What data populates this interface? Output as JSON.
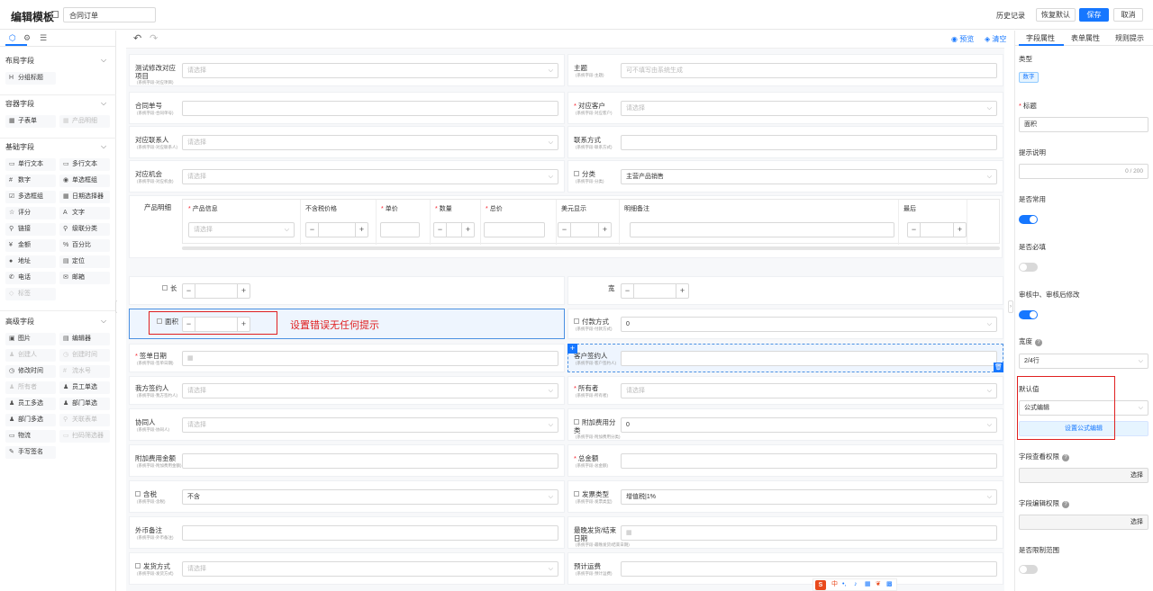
{
  "topbar": {
    "title": "编辑模板",
    "template_name": "合同订单",
    "history": "历史记录",
    "restore_default": "恢复默认",
    "save": "保存",
    "cancel": "取消"
  },
  "left": {
    "sections": [
      {
        "title": "布局字段",
        "items": [
          {
            "label": "分组标题",
            "icon": "H",
            "disabled": false
          }
        ]
      },
      {
        "title": "容器字段",
        "items": [
          {
            "label": "子表单",
            "icon": "▦",
            "disabled": false
          },
          {
            "label": "产品明细",
            "icon": "▦",
            "disabled": true
          }
        ]
      },
      {
        "title": "基础字段",
        "items": [
          {
            "label": "单行文本",
            "icon": "▭",
            "disabled": false
          },
          {
            "label": "多行文本",
            "icon": "▭",
            "disabled": false
          },
          {
            "label": "数字",
            "icon": "#",
            "disabled": false
          },
          {
            "label": "单选框组",
            "icon": "◉",
            "disabled": false
          },
          {
            "label": "多选框组",
            "icon": "☑",
            "disabled": false
          },
          {
            "label": "日期选择器",
            "icon": "▦",
            "disabled": false
          },
          {
            "label": "评分",
            "icon": "☆",
            "disabled": false
          },
          {
            "label": "文字",
            "icon": "A",
            "disabled": false
          },
          {
            "label": "链接",
            "icon": "⚲",
            "disabled": false
          },
          {
            "label": "级联分类",
            "icon": "⚲",
            "disabled": false
          },
          {
            "label": "金额",
            "icon": "¥",
            "disabled": false
          },
          {
            "label": "百分比",
            "icon": "%",
            "disabled": false
          },
          {
            "label": "地址",
            "icon": "●",
            "disabled": false
          },
          {
            "label": "定位",
            "icon": "▤",
            "disabled": false
          },
          {
            "label": "电话",
            "icon": "✆",
            "disabled": false
          },
          {
            "label": "邮箱",
            "icon": "✉",
            "disabled": false
          },
          {
            "label": "标签",
            "icon": "◇",
            "disabled": true
          }
        ]
      },
      {
        "title": "高级字段",
        "items": [
          {
            "label": "图片",
            "icon": "▣",
            "disabled": false
          },
          {
            "label": "编辑器",
            "icon": "▤",
            "disabled": false
          },
          {
            "label": "创建人",
            "icon": "♟",
            "disabled": true
          },
          {
            "label": "创建时间",
            "icon": "◷",
            "disabled": true
          },
          {
            "label": "修改时间",
            "icon": "◷",
            "disabled": false
          },
          {
            "label": "流水号",
            "icon": "#",
            "disabled": true
          },
          {
            "label": "所有者",
            "icon": "♟",
            "disabled": true
          },
          {
            "label": "员工单选",
            "icon": "♟",
            "disabled": false
          },
          {
            "label": "员工多选",
            "icon": "♟",
            "disabled": false
          },
          {
            "label": "部门单选",
            "icon": "♟",
            "disabled": false
          },
          {
            "label": "部门多选",
            "icon": "♟",
            "disabled": false
          },
          {
            "label": "关联表单",
            "icon": "⚲",
            "disabled": true
          },
          {
            "label": "物流",
            "icon": "▭",
            "disabled": false
          },
          {
            "label": "扫码筛选器",
            "icon": "▭",
            "disabled": true
          },
          {
            "label": "手写签名",
            "icon": "✎",
            "disabled": false
          }
        ]
      }
    ]
  },
  "center": {
    "preview": "预览",
    "clear": "清空",
    "fields": {
      "proj": {
        "label": "测试修改对应项目",
        "sub": "(系统字段-对应项目)",
        "placeholder": "请选择"
      },
      "subject": {
        "label": "主题",
        "sub": "(系统字段-主题)",
        "placeholder": "可不填写由系统生成"
      },
      "contract_no": {
        "label": "合同单号",
        "sub": "(系统字段-合同单号)"
      },
      "customer": {
        "label": "对应客户",
        "sub": "(系统字段-对应客户)",
        "placeholder": "请选择"
      },
      "contact": {
        "label": "对应联系人",
        "sub": "(系统字段-对应联系人)",
        "placeholder": "请选择"
      },
      "contact_method": {
        "label": "联系方式",
        "sub": "(系统字段-联系方式)"
      },
      "opportunity": {
        "label": "对应机会",
        "sub": "(系统字段-对应机会)",
        "placeholder": "请选择"
      },
      "category": {
        "label": "分类",
        "sub": "(系统字段-分类)",
        "value": "主营产品销售"
      },
      "product_detail": {
        "label": "产品明细"
      },
      "length": {
        "label": "长"
      },
      "width": {
        "label": "宽"
      },
      "area": {
        "label": "面积"
      },
      "annotation": "设置错误无任何提示",
      "payment": {
        "label": "付款方式",
        "sub": "(系统字段-付款方式)",
        "value": "0"
      },
      "sign_date": {
        "label": "签单日期",
        "sub": "(系统字段-签单日期)"
      },
      "customer_signer": {
        "label": "客户签约人",
        "sub": "(系统字段-客户签约人)"
      },
      "our_signer": {
        "label": "我方签约人",
        "sub": "(系统字段-我方签约人)",
        "placeholder": "请选择"
      },
      "owner": {
        "label": "所有者",
        "sub": "(系统字段-所有者)",
        "placeholder": "请选择"
      },
      "collaborator": {
        "label": "协同人",
        "sub": "(系统字段-协同人)",
        "placeholder": "请选择"
      },
      "extra_fee": {
        "label": "附加费用分类",
        "sub": "(系统字段-附加费用分类)",
        "value": "0"
      },
      "extra_amount": {
        "label": "附加费用金额",
        "sub": "(系统字段-附加费用金额)"
      },
      "total": {
        "label": "总金额",
        "sub": "(系统字段-总金额)"
      },
      "tax": {
        "label": "含税",
        "sub": "(系统字段-含税)",
        "value": "不含"
      },
      "invoice": {
        "label": "发票类型",
        "sub": "(系统字段-发票类型)",
        "value": "增值税|1%"
      },
      "fx_note": {
        "label": "外币备注",
        "sub": "(系统字段-外币备注)"
      },
      "last_ship": {
        "label": "最晚发货/结束日期",
        "sub": "(系统字段-最晚发货/结束日期)"
      },
      "ship_method": {
        "label": "发货方式",
        "sub": "(系统字段-发货方式)",
        "placeholder": "请选择"
      },
      "est_freight": {
        "label": "预计运费",
        "sub": "(系统字段-预计运费)"
      }
    },
    "product_table": {
      "headers": [
        "产品信息",
        "不含税价格",
        "单价",
        "数量",
        "总价",
        "美元显示",
        "明细备注",
        "最后"
      ],
      "select_placeholder": "请选择"
    }
  },
  "right": {
    "tabs": [
      "字段属性",
      "表单属性",
      "规则提示"
    ],
    "type_label": "类型",
    "type_value": "数字",
    "title_label": "标题",
    "title_value": "面积",
    "hint_label": "提示说明",
    "hint_counter": "0 / 200",
    "common_label": "是否常用",
    "common_on": true,
    "required_label": "是否必填",
    "required_on": false,
    "editable_label": "审核中、审核后修改",
    "editable_on": true,
    "width_label": "宽度",
    "width_value": "2/4行",
    "default_label": "默认值",
    "default_value": "公式编辑",
    "formula_button": "设置公式编辑",
    "view_perm_label": "字段查看权限",
    "view_perm_value": "选择",
    "edit_perm_label": "字段编辑权限",
    "edit_perm_value": "选择",
    "limit_label": "是否限制范围",
    "limit_on": false
  },
  "ime": {
    "label": "中"
  },
  "colors": {
    "accent": "#1677ff",
    "annotation": "#e02020"
  }
}
